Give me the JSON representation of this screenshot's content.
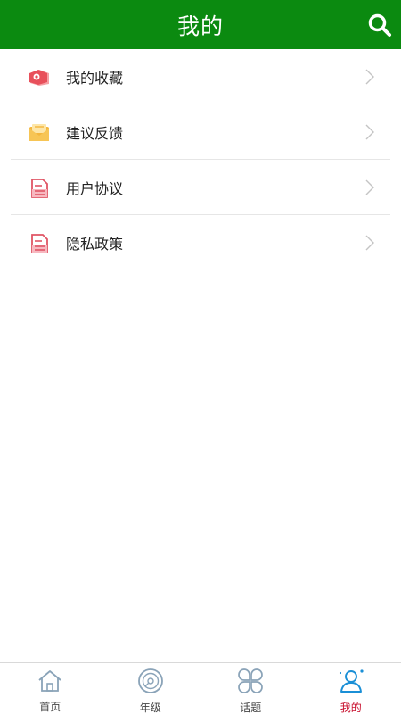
{
  "header": {
    "title": "我的",
    "search_icon": "search-icon"
  },
  "menu": {
    "items": [
      {
        "label": "我的收藏",
        "icon": "favorite-tag-icon"
      },
      {
        "label": "建议反馈",
        "icon": "mail-envelope-icon"
      },
      {
        "label": "用户协议",
        "icon": "document-icon"
      },
      {
        "label": "隐私政策",
        "icon": "document-icon"
      }
    ]
  },
  "tabbar": {
    "active": "我的",
    "tabs": [
      {
        "label": "首页",
        "icon": "home-icon"
      },
      {
        "label": "年级",
        "icon": "disc-icon"
      },
      {
        "label": "话题",
        "icon": "clover-icon"
      },
      {
        "label": "我的",
        "icon": "user-icon"
      }
    ]
  },
  "colors": {
    "header_bg": "#0b8a10",
    "active_tab": "#c8102e",
    "icon_outline": "#8aa3b8",
    "active_icon": "#1a8fd6"
  }
}
